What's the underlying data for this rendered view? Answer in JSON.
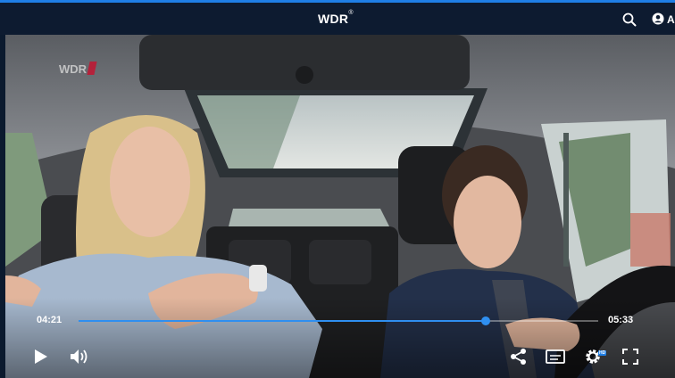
{
  "header": {
    "logo_text": "WDR",
    "logo_mark": "®",
    "account_label": "A",
    "icons": [
      "search-icon",
      "account-icon"
    ],
    "accent": "#1f7fe6",
    "background": "#0d1b30"
  },
  "video": {
    "watermark_text": "WDR",
    "current_time": "04:21",
    "duration": "05:33",
    "progress": 0.784,
    "controls": [
      "play-icon",
      "volume-icon",
      "share-icon",
      "subtitles-icon",
      "settings-icon",
      "fullscreen-icon"
    ],
    "settings_badge": "HD"
  }
}
